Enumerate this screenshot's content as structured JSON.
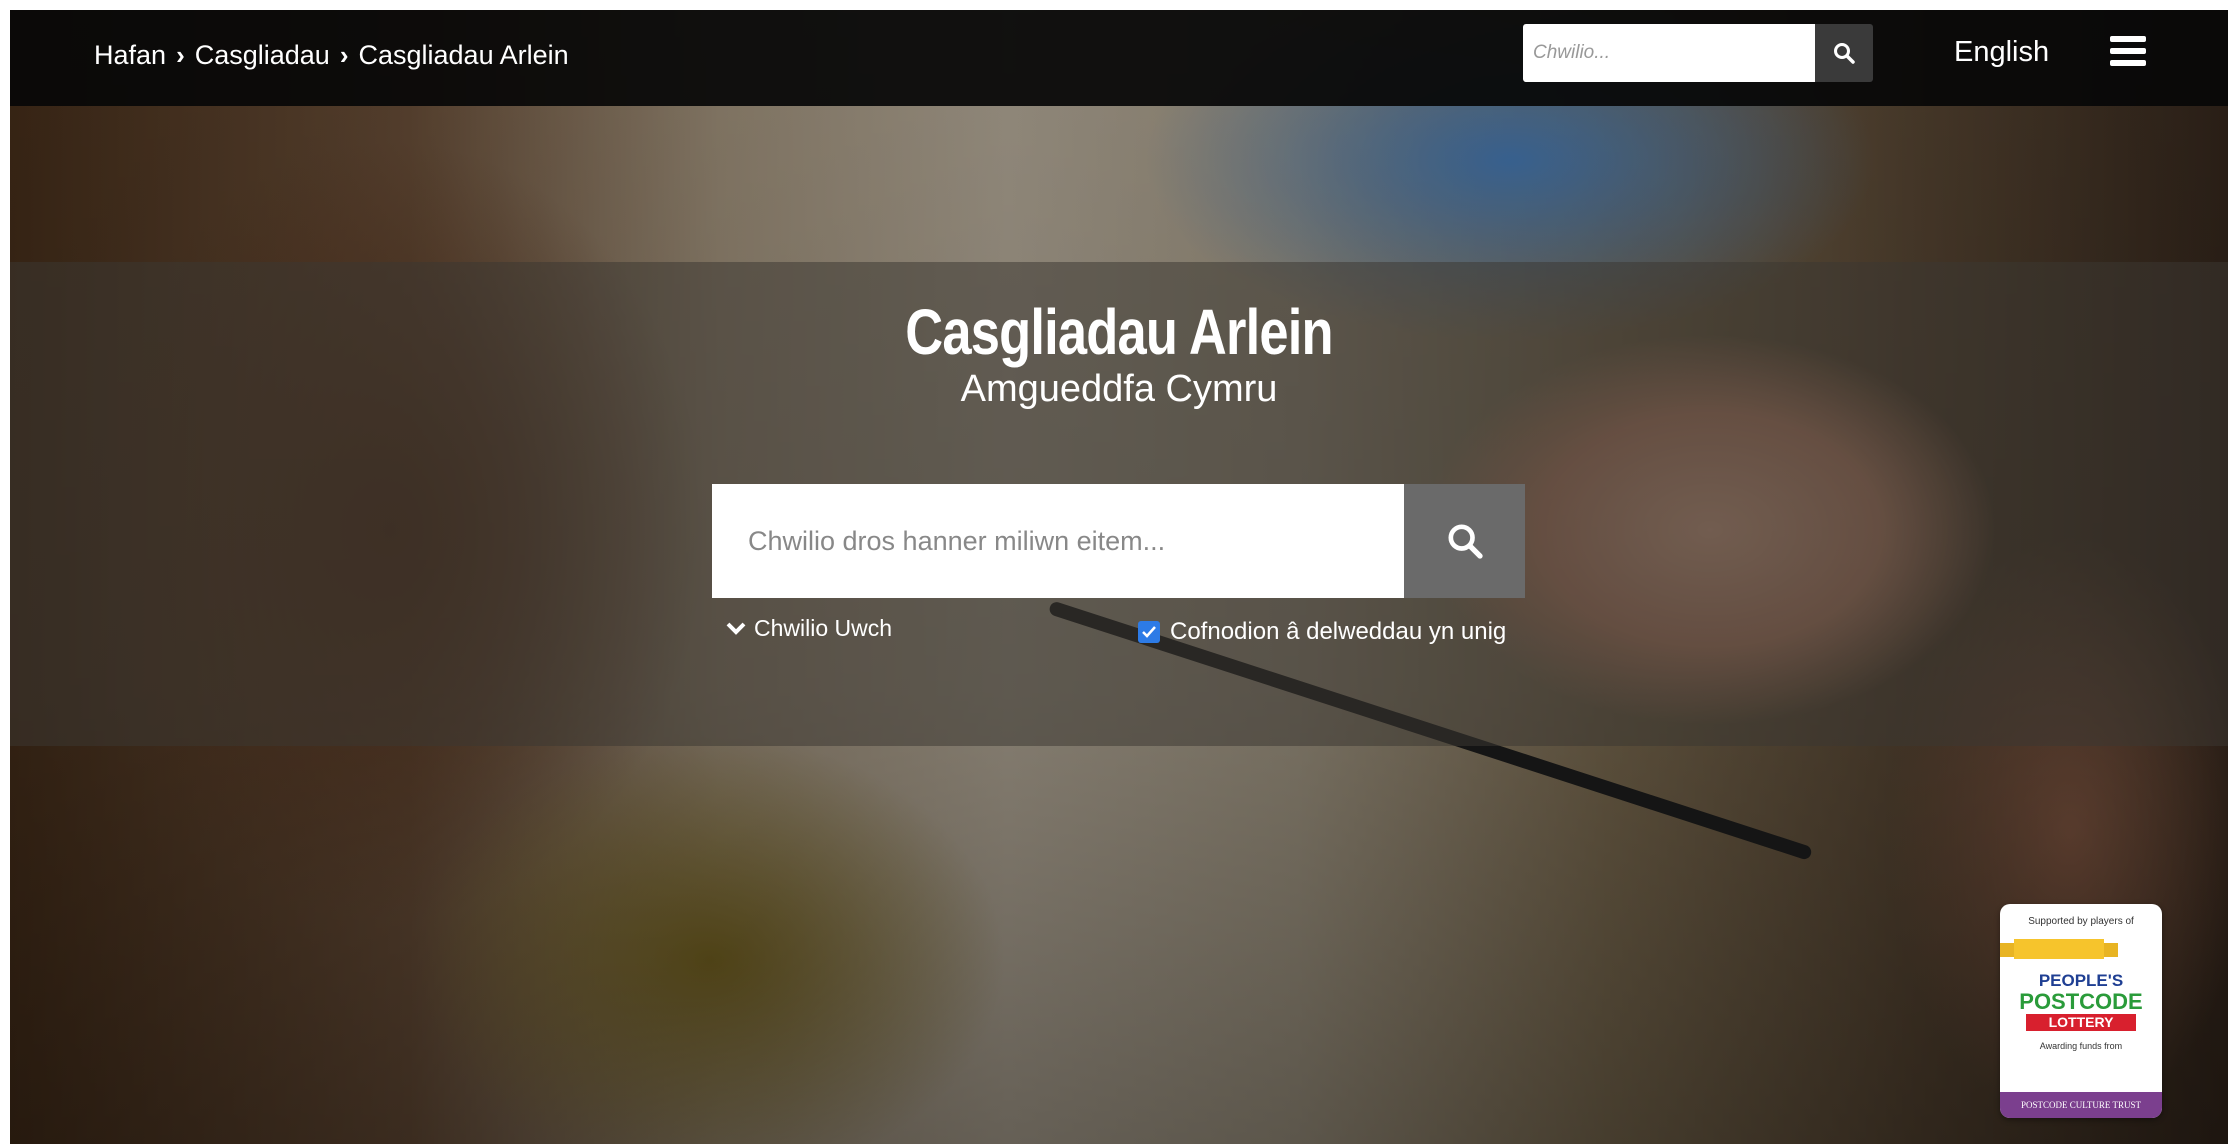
{
  "breadcrumb": {
    "items": [
      "Hafan",
      "Casgliadau",
      "Casgliadau Arlein"
    ],
    "separator": "›"
  },
  "header": {
    "search_placeholder": "Chwilio...",
    "language_link": "English"
  },
  "hero": {
    "title": "Casgliadau Arlein",
    "subtitle": "Amgueddfa Cymru",
    "search_placeholder": "Chwilio dros hanner miliwn eitem...",
    "advanced_search_label": "Chwilio Uwch",
    "images_only_label": "Cofnodion â delweddau yn unig",
    "images_only_checked": true
  },
  "badge": {
    "top_text": "Supported by players of",
    "line1": "PEOPLE'S",
    "line2": "POSTCODE",
    "line3": "LOTTERY",
    "awarding_text": "Awarding funds from",
    "trust_text": "POSTCODE CULTURE TRUST"
  },
  "colors": {
    "topbar": "#080808",
    "search_button": "#6a6a6a",
    "checkbox": "#2d7be6",
    "badge_purple": "#7b3f8e",
    "badge_green": "#2a9b3a",
    "badge_blue": "#1f3f93",
    "badge_red": "#d8202e"
  }
}
